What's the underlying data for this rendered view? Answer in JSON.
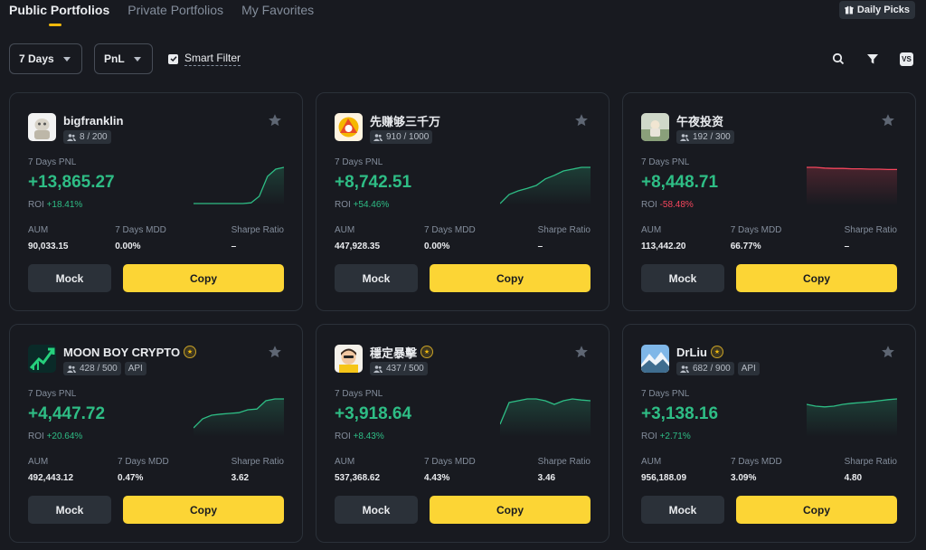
{
  "tabs": [
    {
      "label": "Public Portfolios",
      "active": true
    },
    {
      "label": "Private Portfolios",
      "active": false
    },
    {
      "label": "My Favorites",
      "active": false
    }
  ],
  "daily_picks": {
    "label": "Daily Picks",
    "icon": "gift-icon"
  },
  "filters": {
    "period": {
      "selected": "7 Days"
    },
    "sort": {
      "selected": "PnL"
    },
    "smart_filter": {
      "label": "Smart Filter",
      "checked": true
    }
  },
  "toolbar": {
    "icons": [
      "search-icon",
      "filter-icon",
      "vs-icon"
    ],
    "vs_label": "VS"
  },
  "colors": {
    "positive": "#2ebd85",
    "negative": "#f6465d",
    "accent": "#fcd535",
    "background": "#181a20"
  },
  "cards": [
    {
      "name": "bigfranklin",
      "followers": "8 / 200",
      "api": "",
      "medal": false,
      "pnl_label": "7 Days PNL",
      "pnl": "+13,865.27",
      "roi_label": "ROI",
      "roi": "+18.41%",
      "roi_negative": false,
      "aum_label": "AUM",
      "aum": "90,033.15",
      "mdd_label": "7 Days MDD",
      "mdd": "0.00%",
      "sharpe_label": "Sharpe Ratio",
      "sharpe": "–",
      "mock_label": "Mock",
      "copy_label": "Copy",
      "trend": [
        0,
        0,
        0,
        0,
        0,
        0,
        0,
        0.02,
        0.2,
        0.75,
        0.95,
        1.0
      ],
      "trend_color": "#2ebd85"
    },
    {
      "name": "先赚够三千万",
      "followers": "910 / 1000",
      "api": "",
      "medal": false,
      "pnl_label": "7 Days PNL",
      "pnl": "+8,742.51",
      "roi_label": "ROI",
      "roi": "+54.46%",
      "roi_negative": false,
      "aum_label": "AUM",
      "aum": "447,928.35",
      "mdd_label": "7 Days MDD",
      "mdd": "0.00%",
      "sharpe_label": "Sharpe Ratio",
      "sharpe": "–",
      "mock_label": "Mock",
      "copy_label": "Copy",
      "trend": [
        0,
        0.25,
        0.35,
        0.42,
        0.5,
        0.68,
        0.78,
        0.9,
        0.95,
        1.0,
        1.0
      ],
      "trend_color": "#2ebd85"
    },
    {
      "name": "午夜投资",
      "followers": "192 / 300",
      "api": "",
      "medal": false,
      "pnl_label": "7 Days PNL",
      "pnl": "+8,448.71",
      "roi_label": "ROI",
      "roi": "-58.48%",
      "roi_negative": true,
      "aum_label": "AUM",
      "aum": "113,442.20",
      "mdd_label": "7 Days MDD",
      "mdd": "66.77%",
      "sharpe_label": "Sharpe Ratio",
      "sharpe": "–",
      "mock_label": "Mock",
      "copy_label": "Copy",
      "trend": [
        1.0,
        1.0,
        0.98,
        0.97,
        0.97,
        0.96,
        0.96,
        0.95,
        0.95,
        0.94,
        0.94
      ],
      "trend_color": "#f6465d"
    },
    {
      "name": "MOON BOY CRYPTO",
      "followers": "428 / 500",
      "api": "API",
      "medal": true,
      "pnl_label": "7 Days PNL",
      "pnl": "+4,447.72",
      "roi_label": "ROI",
      "roi": "+20.64%",
      "roi_negative": false,
      "aum_label": "AUM",
      "aum": "492,443.12",
      "mdd_label": "7 Days MDD",
      "mdd": "0.47%",
      "sharpe_label": "Sharpe Ratio",
      "sharpe": "3.62",
      "mock_label": "Mock",
      "copy_label": "Copy",
      "trend": [
        0.2,
        0.45,
        0.55,
        0.58,
        0.6,
        0.62,
        0.7,
        0.72,
        0.95,
        1.0,
        1.0
      ],
      "trend_color": "#2ebd85"
    },
    {
      "name": "穩定暴擊",
      "followers": "437 / 500",
      "api": "",
      "medal": true,
      "pnl_label": "7 Days PNL",
      "pnl": "+3,918.64",
      "roi_label": "ROI",
      "roi": "+8.43%",
      "roi_negative": false,
      "aum_label": "AUM",
      "aum": "537,368.62",
      "mdd_label": "7 Days MDD",
      "mdd": "4.43%",
      "sharpe_label": "Sharpe Ratio",
      "sharpe": "3.46",
      "mock_label": "Mock",
      "copy_label": "Copy",
      "trend": [
        0.3,
        0.9,
        0.95,
        1.0,
        1.0,
        0.95,
        0.85,
        0.95,
        1.0,
        0.97,
        0.95
      ],
      "trend_color": "#2ebd85"
    },
    {
      "name": "DrLiu",
      "followers": "682 / 900",
      "api": "API",
      "medal": true,
      "pnl_label": "7 Days PNL",
      "pnl": "+3,138.16",
      "roi_label": "ROI",
      "roi": "+2.71%",
      "roi_negative": false,
      "aum_label": "AUM",
      "aum": "956,188.09",
      "mdd_label": "7 Days MDD",
      "mdd": "3.09%",
      "sharpe_label": "Sharpe Ratio",
      "sharpe": "4.80",
      "mock_label": "Mock",
      "copy_label": "Copy",
      "trend": [
        0.85,
        0.8,
        0.78,
        0.8,
        0.85,
        0.88,
        0.9,
        0.92,
        0.95,
        0.98,
        1.0
      ],
      "trend_color": "#2ebd85"
    }
  ]
}
